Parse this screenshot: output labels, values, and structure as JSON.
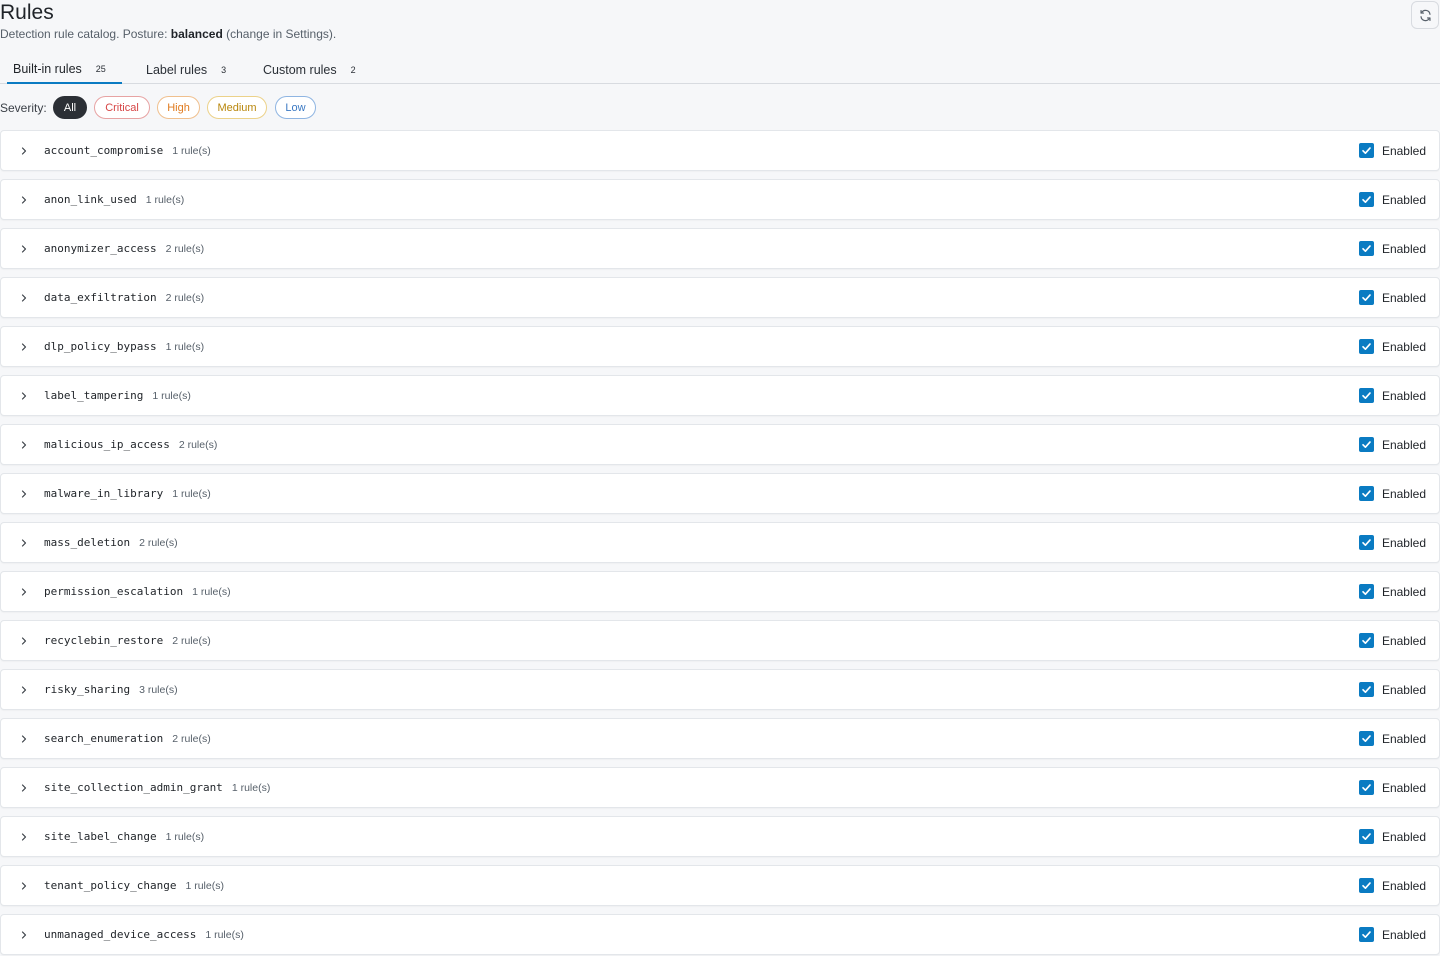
{
  "header": {
    "title": "Rules",
    "subtitle_prefix": "Detection rule catalog. Posture: ",
    "posture": "balanced",
    "subtitle_suffix": " (change in Settings).",
    "refresh_icon": "refresh-icon"
  },
  "tabs": [
    {
      "label": "Built-in rules",
      "count": "25",
      "active": true
    },
    {
      "label": "Label rules",
      "count": "3",
      "active": false
    },
    {
      "label": "Custom rules",
      "count": "2",
      "active": false
    }
  ],
  "severity": {
    "label": "Severity:",
    "options": [
      "All",
      "Critical",
      "High",
      "Medium",
      "Low"
    ],
    "selected": "All",
    "colors": {
      "critical": "#d64545",
      "high": "#e07b1f",
      "medium": "#b8860b",
      "low": "#3b79c3",
      "accent": "#0a7bc2"
    }
  },
  "enabled_label": "Enabled",
  "rules": [
    {
      "name": "account_compromise",
      "count": "1 rule(s)"
    },
    {
      "name": "anon_link_used",
      "count": "1 rule(s)"
    },
    {
      "name": "anonymizer_access",
      "count": "2 rule(s)"
    },
    {
      "name": "data_exfiltration",
      "count": "2 rule(s)"
    },
    {
      "name": "dlp_policy_bypass",
      "count": "1 rule(s)"
    },
    {
      "name": "label_tampering",
      "count": "1 rule(s)"
    },
    {
      "name": "malicious_ip_access",
      "count": "2 rule(s)"
    },
    {
      "name": "malware_in_library",
      "count": "1 rule(s)"
    },
    {
      "name": "mass_deletion",
      "count": "2 rule(s)"
    },
    {
      "name": "permission_escalation",
      "count": "1 rule(s)"
    },
    {
      "name": "recyclebin_restore",
      "count": "2 rule(s)"
    },
    {
      "name": "risky_sharing",
      "count": "3 rule(s)"
    },
    {
      "name": "search_enumeration",
      "count": "2 rule(s)"
    },
    {
      "name": "site_collection_admin_grant",
      "count": "1 rule(s)"
    },
    {
      "name": "site_label_change",
      "count": "1 rule(s)"
    },
    {
      "name": "tenant_policy_change",
      "count": "1 rule(s)"
    },
    {
      "name": "unmanaged_device_access",
      "count": "1 rule(s)"
    }
  ]
}
